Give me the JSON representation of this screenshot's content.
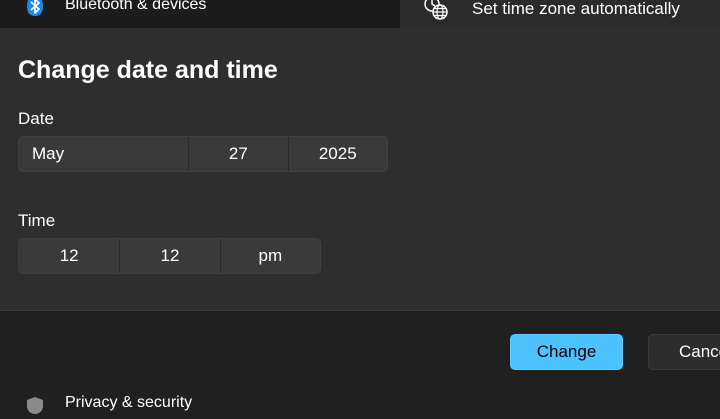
{
  "background": {
    "nav_item_label": "Bluetooth & devices",
    "setting_label": "Set time zone automatically",
    "bottom_nav_label": "Privacy & security"
  },
  "dialog": {
    "title": "Change date and time",
    "date_label": "Date",
    "date": {
      "month": "May",
      "day": "27",
      "year": "2025"
    },
    "time_label": "Time",
    "time": {
      "hour": "12",
      "minute": "12",
      "period": "pm"
    },
    "primary_button": "Change",
    "secondary_button": "Cancel"
  },
  "colors": {
    "accent": "#4cc2ff",
    "dialog_bg": "#2e2e2e",
    "footer_bg": "#202020"
  }
}
